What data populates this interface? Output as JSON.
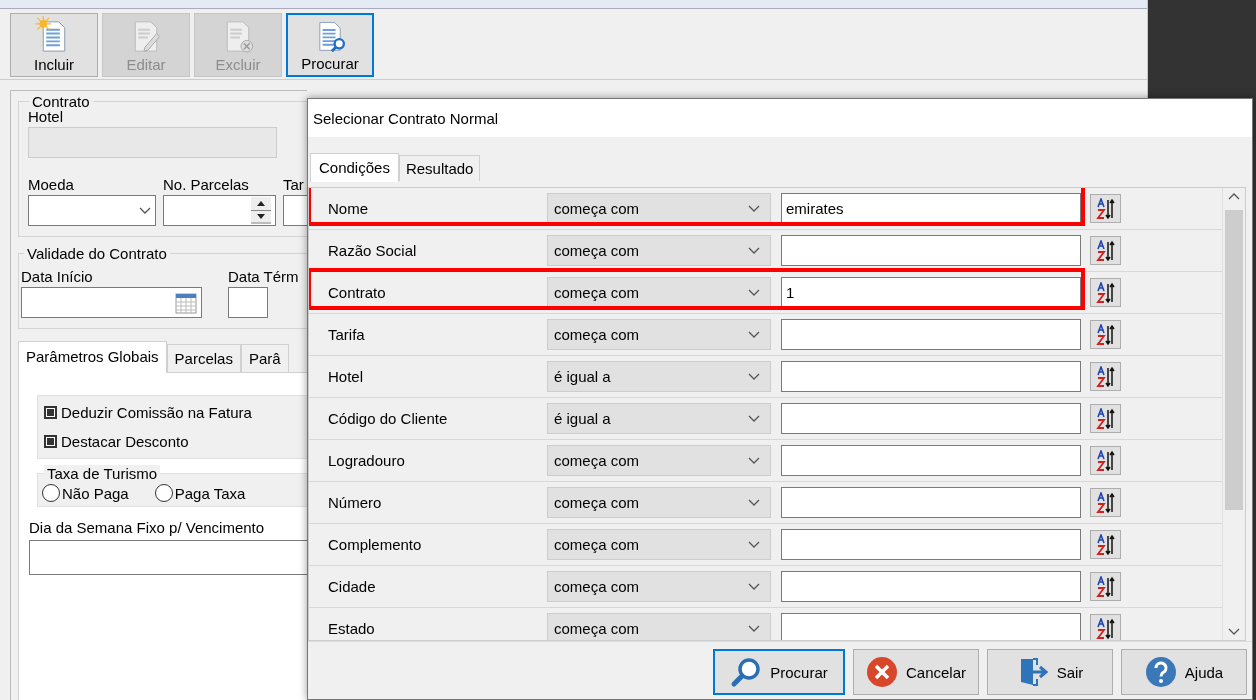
{
  "toolbar": [
    {
      "label": "Incluir",
      "kind": "new",
      "disabled": false,
      "focused": false
    },
    {
      "label": "Editar",
      "kind": "edit",
      "disabled": true,
      "focused": false
    },
    {
      "label": "Excluir",
      "kind": "delete",
      "disabled": true,
      "focused": false
    },
    {
      "label": "Procurar",
      "kind": "find",
      "disabled": false,
      "focused": true
    }
  ],
  "form": {
    "contract_group": "Contrato",
    "hotel_label": "Hotel",
    "fields_row": [
      {
        "label": "Moeda",
        "kind": "combo"
      },
      {
        "label": "No. Parcelas",
        "kind": "spin"
      },
      {
        "label": "Tar",
        "kind": "text"
      }
    ],
    "validity_group": "Validade do Contrato",
    "date_fields": [
      {
        "label": "Data Início",
        "kind": "date"
      },
      {
        "label": "Data Térm",
        "kind": "text"
      }
    ],
    "tabs": [
      {
        "label": "Parâmetros Globais",
        "selected": true
      },
      {
        "label": "Parcelas",
        "selected": false
      },
      {
        "label": "Parâ",
        "selected": false
      }
    ],
    "checkboxes": [
      {
        "label": "Deduzir Comissão na Fatura",
        "checked": true
      },
      {
        "label": "Destacar Desconto",
        "checked": true
      }
    ],
    "tourism_group": "Taxa de Turismo",
    "radios": [
      {
        "label": "Não Paga",
        "selected": false
      },
      {
        "label": "Paga Taxa",
        "selected": false
      }
    ],
    "weekday_label": "Dia da Semana Fixo p/ Vencimento"
  },
  "dialog": {
    "title": "Selecionar Contrato Normal",
    "tabs": [
      {
        "label": "Condições",
        "selected": true
      },
      {
        "label": "Resultado",
        "selected": false
      }
    ],
    "conditions": [
      {
        "field": "Nome",
        "operator": "começa com",
        "value": "emirates",
        "highlighted": true
      },
      {
        "field": "Razão Social",
        "operator": "começa com",
        "highlighted": false
      },
      {
        "field": "Contrato",
        "operator": "começa com",
        "value": "1",
        "highlighted": true
      },
      {
        "field": "Tarifa",
        "operator": "começa com",
        "highlighted": false
      },
      {
        "field": "Hotel",
        "operator": "é igual a",
        "highlighted": false
      },
      {
        "field": "Código do Cliente",
        "operator": "é igual a",
        "highlighted": false
      },
      {
        "field": "Logradouro",
        "operator": "começa com",
        "highlighted": false
      },
      {
        "field": "Número",
        "operator": "começa com",
        "highlighted": false
      },
      {
        "field": "Complemento",
        "operator": "começa com",
        "highlighted": false
      },
      {
        "field": "Cidade",
        "operator": "começa com",
        "highlighted": false
      },
      {
        "field": "Estado",
        "operator": "começa com",
        "highlighted": false
      }
    ],
    "buttons": [
      {
        "label": "Procurar",
        "kind": "search",
        "focused": true
      },
      {
        "label": "Cancelar",
        "kind": "cancel",
        "focused": false
      },
      {
        "label": "Sair",
        "kind": "exit",
        "focused": false
      },
      {
        "label": "Ajuda",
        "kind": "help",
        "focused": false
      }
    ]
  }
}
